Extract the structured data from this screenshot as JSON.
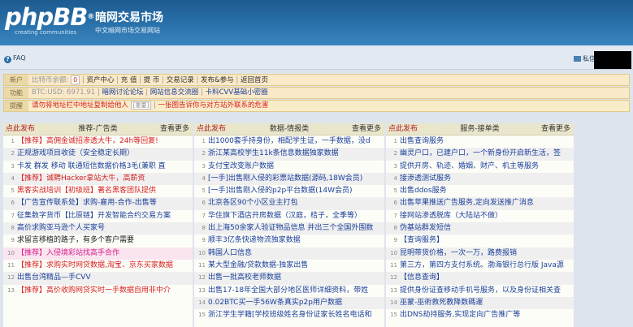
{
  "header": {
    "logo_text": "phpBB",
    "logo_reg": "®",
    "logo_sub": "creating communities",
    "site_title": "暗网交易市场",
    "site_desc": "中文暗网市场交易网站"
  },
  "navbar": {
    "faq_label": "FAQ",
    "pm_label": "私信"
  },
  "info": {
    "row1": {
      "label": "新户",
      "balance_label": "比特币余额:",
      "balance_value": "0",
      "links": [
        "资产中心",
        "充 值",
        "提 币",
        "交易记录",
        "发布&参与",
        "返回首页"
      ]
    },
    "row2": {
      "label": "功能",
      "rate": "BTC:USD: 6971.91",
      "links": [
        "暗网讨论论坛",
        "网站信息交流圈",
        "卡料CVV基础小密圈"
      ]
    },
    "row3": {
      "label": "提醒",
      "text1": "请勿将地址栏中地址复制给他人",
      "box": "[重要]",
      "text2": "一张图告诉你与对方站外联系的危害"
    }
  },
  "columns": [
    {
      "left": "点此发布",
      "title": "推荐-广告类",
      "more": "查看更多",
      "items": [
        {
          "n": "1",
          "text": "【推荐】高佣金诚招渗透大牛，24h等回复!",
          "color": "#d61f1f"
        },
        {
          "n": "2",
          "text": "正规游戏项目收徒（安全稳定长期）",
          "color": "#1a3f9a"
        },
        {
          "n": "3",
          "text": "卡发 群发 移动 联通短信数据价格3毛(兼职 直",
          "color": "#1a3f9a"
        },
        {
          "n": "4",
          "text": "【推荐】诚聘Hacker拿站大牛，高薪资",
          "color": "#d61f1f"
        },
        {
          "n": "5",
          "text": "黑客实战培训【初级班】著名黑客团队提供",
          "color": "#d61f1f"
        },
        {
          "n": "6",
          "text": "【广告宣传联系处】求购-雇用-合作-出售等",
          "color": "#1a3f9a"
        },
        {
          "n": "7",
          "text": "征集数字货币【比原链】开发智能合约交易方案",
          "color": "#1a3f9a"
        },
        {
          "n": "8",
          "text": "高价求购亚马逊个人买家号",
          "color": "#1a3f9a"
        },
        {
          "n": "9",
          "text": "求留言移植的路子，有多个客户需要",
          "color": "#222222"
        },
        {
          "n": "10",
          "text": "【推荐】入侵境彩站找高手合作",
          "color": "#d61f8a",
          "hl": true
        },
        {
          "n": "11",
          "text": "【推荐】求购实时网贷数据,淘宝、京东买家数据",
          "color": "#d61f1f"
        },
        {
          "n": "12",
          "text": "出售台湾精品—手CVV",
          "color": "#1a3f9a"
        },
        {
          "n": "13",
          "text": "【推荐】高价收购网贷实时一手数据自用非中介",
          "color": "#d61f1f"
        }
      ]
    },
    {
      "left": "点此发布",
      "title": "数据-情报类",
      "more": "查看更多",
      "items": [
        {
          "n": "1",
          "text": "出1000套手持身份，相配学生证，一手数据，没d",
          "color": "#1a3f9a"
        },
        {
          "n": "2",
          "text": "浙江某高校学生11k条信息数据独家数据",
          "color": "#1a3f9a"
        },
        {
          "n": "3",
          "text": "支付宝改变账户数据",
          "color": "#1a3f9a"
        },
        {
          "n": "4",
          "text": "[一手]出售刚入侵的彩票站数据(源码,18W会员)",
          "color": "#1a3f9a"
        },
        {
          "n": "5",
          "text": "[一手]出售刚入侵的p2p平台数据(14W会员)",
          "color": "#1a3f9a"
        },
        {
          "n": "6",
          "text": "北京各区90个小区业主打包",
          "color": "#1a3f9a"
        },
        {
          "n": "7",
          "text": "华住旗下酒店开房数据（汉庭，桔子，全季等）",
          "color": "#1a3f9a"
        },
        {
          "n": "8",
          "text": "出上海50余家人验证物品信息 并出三个全国外围数",
          "color": "#1a3f9a"
        },
        {
          "n": "9",
          "text": "顺丰3亿条快递物流独家数据",
          "color": "#1a3f9a"
        },
        {
          "n": "10",
          "text": "韩国人口信息",
          "color": "#1a3f9a"
        },
        {
          "n": "11",
          "text": "某大型金融/贷款数据-独家出售",
          "color": "#1a3f9a"
        },
        {
          "n": "12",
          "text": "出售一批高校老师数据",
          "color": "#1a3f9a"
        },
        {
          "n": "13",
          "text": "出售17-18年全国大部分地区医师详细资料，带姓",
          "color": "#1a3f9a"
        },
        {
          "n": "14",
          "text": "0.02BTC买一手56W条真实p2p用户数据",
          "color": "#1a3f9a"
        },
        {
          "n": "15",
          "text": "浙江学生学籍[学校班级姓名身份证家长姓名电话和",
          "color": "#1a3f9a"
        }
      ]
    },
    {
      "left": "点此发布",
      "title": "服务-接单类",
      "more": "查看更多",
      "items": [
        {
          "n": "1",
          "text": "出售查询服务",
          "color": "#1a3f9a"
        },
        {
          "n": "2",
          "text": "幽灵户口，已建户口，一个新身份开启新生活，签",
          "color": "#1a3f9a"
        },
        {
          "n": "3",
          "text": "提供开房、轨迹、婚姻、财产、机主等服务",
          "color": "#1a3f9a"
        },
        {
          "n": "4",
          "text": "接渗透测试服务",
          "color": "#1a3f9a"
        },
        {
          "n": "5",
          "text": "出售ddos服务",
          "color": "#1a3f9a"
        },
        {
          "n": "6",
          "text": "出售苹果推送广告服务,定向发送推广消息",
          "color": "#1a3f9a"
        },
        {
          "n": "7",
          "text": "接网站渗透脱库（大陆站不做）",
          "color": "#1a3f9a"
        },
        {
          "n": "8",
          "text": "伪基站群发短信",
          "color": "#1a3f9a"
        },
        {
          "n": "9",
          "text": "【查询服务】",
          "color": "#1a3f9a"
        },
        {
          "n": "10",
          "text": "昆明带货价格，一次一万，路费报销",
          "color": "#1a3f9a"
        },
        {
          "n": "11",
          "text": "第三方，第四方支付系统。渤海银行总行版 Java源",
          "color": "#1a3f9a"
        },
        {
          "n": "12",
          "text": "【信息查询】",
          "color": "#1a3f9a"
        },
        {
          "n": "13",
          "text": "提供身份证查移动手机号服务，以及身份证相关查",
          "color": "#1a3f9a"
        },
        {
          "n": "14",
          "text": "巫蒙-巫術救死教降数碼運",
          "color": "#1a3f9a"
        },
        {
          "n": "15",
          "text": "出DNS劫持服务,实现定向广告推广等",
          "color": "#1a3f9a"
        }
      ]
    }
  ]
}
